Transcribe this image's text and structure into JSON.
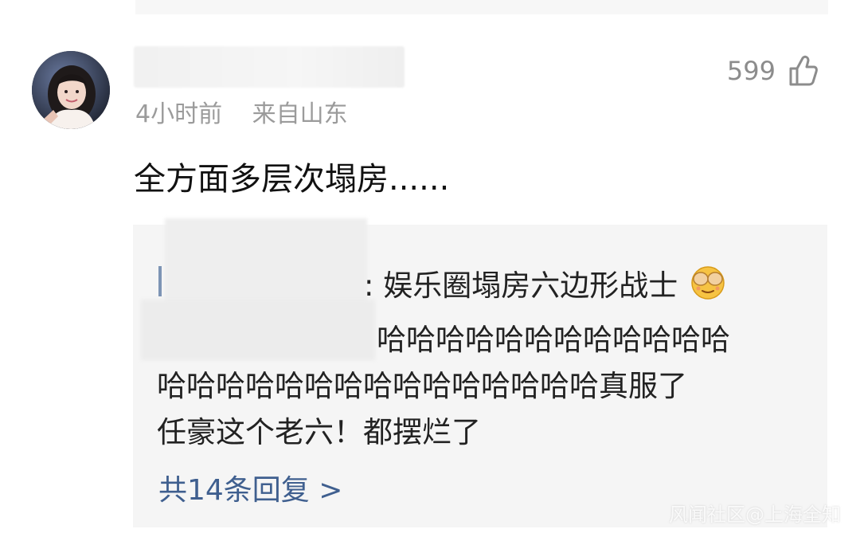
{
  "comment": {
    "time": "4小时前",
    "location": "来自山东",
    "likes": "599",
    "text": "全方面多层次塌房......"
  },
  "reply": {
    "line1": ": 娱乐圈塌房六边形战士",
    "line2": "哈哈哈哈哈哈哈哈哈哈哈哈",
    "line3": "哈哈哈哈哈哈哈哈哈哈哈哈哈哈哈真服了",
    "line4": "任豪这个老六！都摆烂了",
    "emoji": "see-no-evil-face-icon"
  },
  "more_replies": "共14条回复 >",
  "watermark": "风闻社区@上海全知"
}
